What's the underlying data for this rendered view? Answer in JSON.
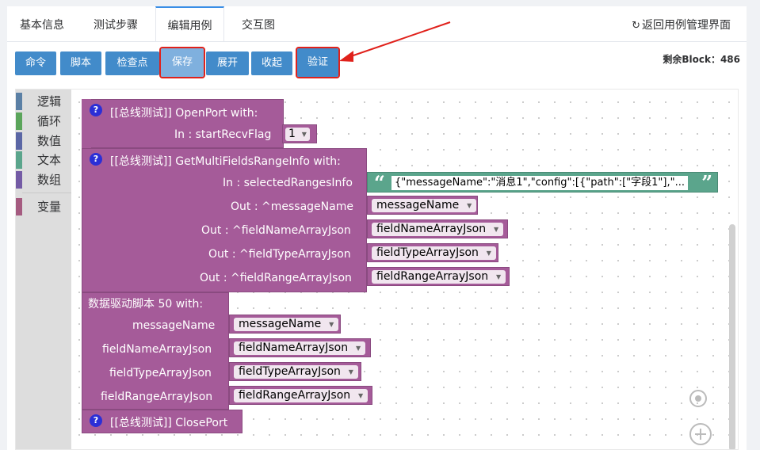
{
  "tabs": [
    "基本信息",
    "测试步骤",
    "编辑用例",
    "交互图"
  ],
  "back_link": "返回用例管理界面",
  "toolbar": [
    "命令",
    "脚本",
    "检查点",
    "保存",
    "展开",
    "收起",
    "验证"
  ],
  "remaining_blocks": "剩余Block：486",
  "categories": [
    {
      "label": "逻辑",
      "color": "#5b80a5"
    },
    {
      "label": "循环",
      "color": "#5ba55b"
    },
    {
      "label": "数值",
      "color": "#5b67a5"
    },
    {
      "label": "文本",
      "color": "#5ba58c"
    },
    {
      "label": "数组",
      "color": "#745ba5"
    },
    {
      "label": "变量",
      "color": "#a55b80"
    }
  ],
  "blocks": {
    "open_port": {
      "title": "[[总线测试]]  OpenPort   with:",
      "arg_label": "In : startRecvFlag",
      "arg_value": "1"
    },
    "get_multi": {
      "title": "[[总线测试]]  GetMultiFieldsRangeInfo   with:",
      "in_label": "In : selectedRangesInfo",
      "in_value": "{\"messageName\":\"消息1\",\"config\":[{\"path\":[\"字段1\"],\"...",
      "outs": [
        {
          "label": "Out : ^messageName",
          "value": "messageName"
        },
        {
          "label": "Out : ^fieldNameArrayJson",
          "value": "fieldNameArrayJson"
        },
        {
          "label": "Out : ^fieldTypeArrayJson",
          "value": "fieldTypeArrayJson"
        },
        {
          "label": "Out : ^fieldRangeArrayJson",
          "value": "fieldRangeArrayJson"
        }
      ]
    },
    "data_driven": {
      "title": "数据驱动脚本  50   with:",
      "args": [
        {
          "label": "messageName",
          "value": "messageName"
        },
        {
          "label": "fieldNameArrayJson",
          "value": "fieldNameArrayJson"
        },
        {
          "label": "fieldTypeArrayJson",
          "value": "fieldTypeArrayJson"
        },
        {
          "label": "fieldRangeArrayJson",
          "value": "fieldRangeArrayJson"
        }
      ]
    },
    "close_port": {
      "title": "[[总线测试]]  ClosePort"
    }
  },
  "help_glyph": "?",
  "quote_open": "“",
  "quote_close": "”",
  "icons": {
    "back": "return-arrow-icon",
    "dropdown": "triangle-down-icon",
    "target": "crosshair-icon",
    "zoom": "plus-circle-icon"
  },
  "annotation_color": "#e0211b"
}
